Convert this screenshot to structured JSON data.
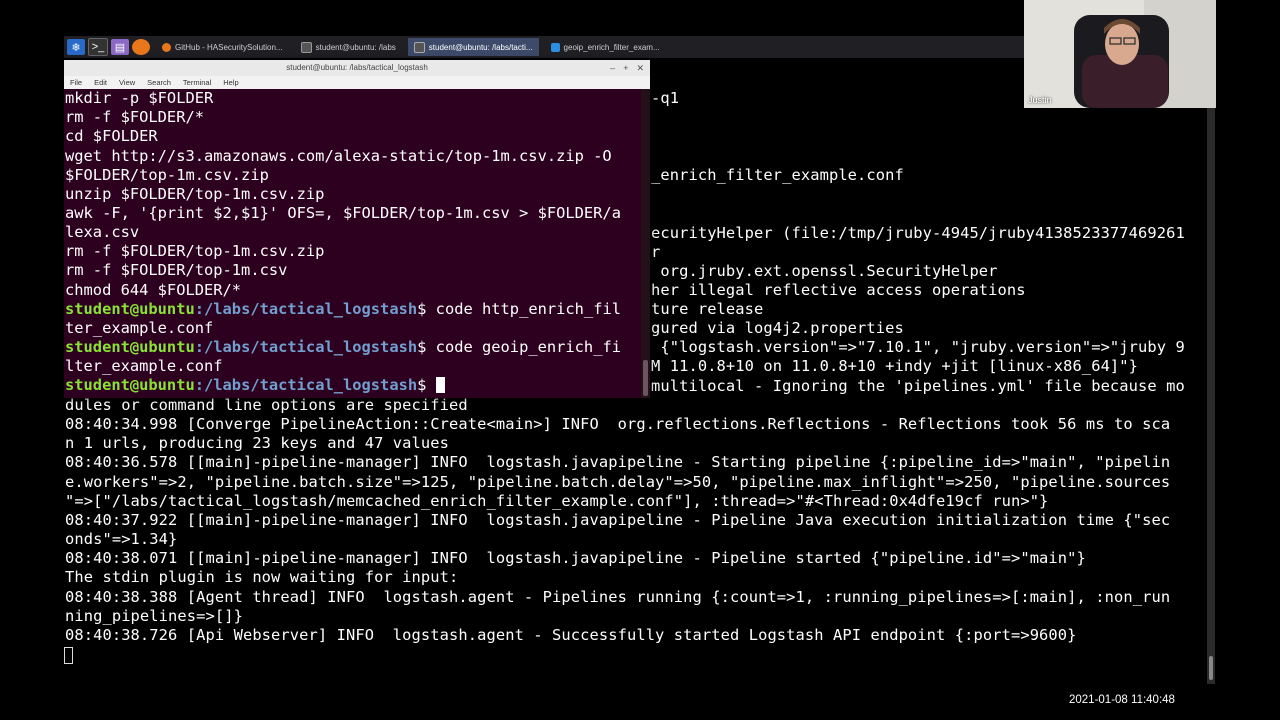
{
  "taskbar": {
    "tasks": [
      {
        "label": "GitHub - HASecuritySolution...",
        "active": false
      },
      {
        "label": "student@ubuntu: /labs",
        "active": false
      },
      {
        "label": "student@ubuntu: /labs/tacti...",
        "active": true
      },
      {
        "label": "geoip_enrich_filter_exam...",
        "active": false
      }
    ]
  },
  "foreground_terminal": {
    "title": "student@ubuntu: /labs/tactical_logstash",
    "menu": [
      "File",
      "Edit",
      "View",
      "Search",
      "Terminal",
      "Help"
    ],
    "prompt_user": "student@ubuntu",
    "prompt_path": ":/labs/tactical_logstash",
    "prompt_sign": "$ ",
    "lines": [
      "mkdir -p $FOLDER",
      "rm -f $FOLDER/*",
      "cd $FOLDER",
      "wget http://s3.amazonaws.com/alexa-static/top-1m.csv.zip -O",
      "$FOLDER/top-1m.csv.zip",
      "unzip $FOLDER/top-1m.csv.zip",
      "awk -F, '{print $2,$1}' OFS=, $FOLDER/top-1m.csv > $FOLDER/a",
      "lexa.csv",
      "rm -f $FOLDER/top-1m.csv.zip",
      "rm -f $FOLDER/top-1m.csv",
      "chmod 644 $FOLDER/*"
    ],
    "cmd1": "code http_enrich_fil",
    "cmd1_wrap": "ter_example.conf",
    "cmd2": "code geoip_enrich_fi",
    "cmd2_wrap": "lter_example.conf"
  },
  "background_terminal": {
    "partial_lines": [
      "-q1",
      "_enrich_filter_example.conf",
      "ecurityHelper (file:/tmp/jruby-4945/jruby4138523377469261",
      "r",
      " org.jruby.ext.openssl.SecurityHelper",
      "her illegal reflective access operations",
      "ture release",
      "gured via log4j2.properties",
      " {\"logstash.version\"=>\"7.10.1\", \"jruby.version\"=>\"jruby 9",
      "M 11.0.8+10 on 11.0.8+10 +indy +jit [linux-x86_64]\"}",
      "multilocal - Ignoring the 'pipelines.yml' file because mo"
    ],
    "full_lines": [
      "dules or command line options are specified",
      "08:40:34.998 [Converge PipelineAction::Create<main>] INFO  org.reflections.Reflections - Reflections took 56 ms to sca",
      "n 1 urls, producing 23 keys and 47 values",
      "08:40:36.578 [[main]-pipeline-manager] INFO  logstash.javapipeline - Starting pipeline {:pipeline_id=>\"main\", \"pipelin",
      "e.workers\"=>2, \"pipeline.batch.size\"=>125, \"pipeline.batch.delay\"=>50, \"pipeline.max_inflight\"=>250, \"pipeline.sources",
      "\"=>[\"/labs/tactical_logstash/memcached_enrich_filter_example.conf\"], :thread=>\"#<Thread:0x4dfe19cf run>\"}",
      "08:40:37.922 [[main]-pipeline-manager] INFO  logstash.javapipeline - Pipeline Java execution initialization time {\"sec",
      "onds\"=>1.34}",
      "08:40:38.071 [[main]-pipeline-manager] INFO  logstash.javapipeline - Pipeline started {\"pipeline.id\"=>\"main\"}",
      "The stdin plugin is now waiting for input:",
      "08:40:38.388 [Agent thread] INFO  logstash.agent - Pipelines running {:count=>1, :running_pipelines=>[:main], :non_run",
      "ning_pipelines=>[]}",
      "08:40:38.726 [Api Webserver] INFO  logstash.agent - Successfully started Logstash API endpoint {:port=>9600}"
    ]
  },
  "webcam": {
    "name": "Justin"
  },
  "clock": "2021-01-08  11:40:48"
}
